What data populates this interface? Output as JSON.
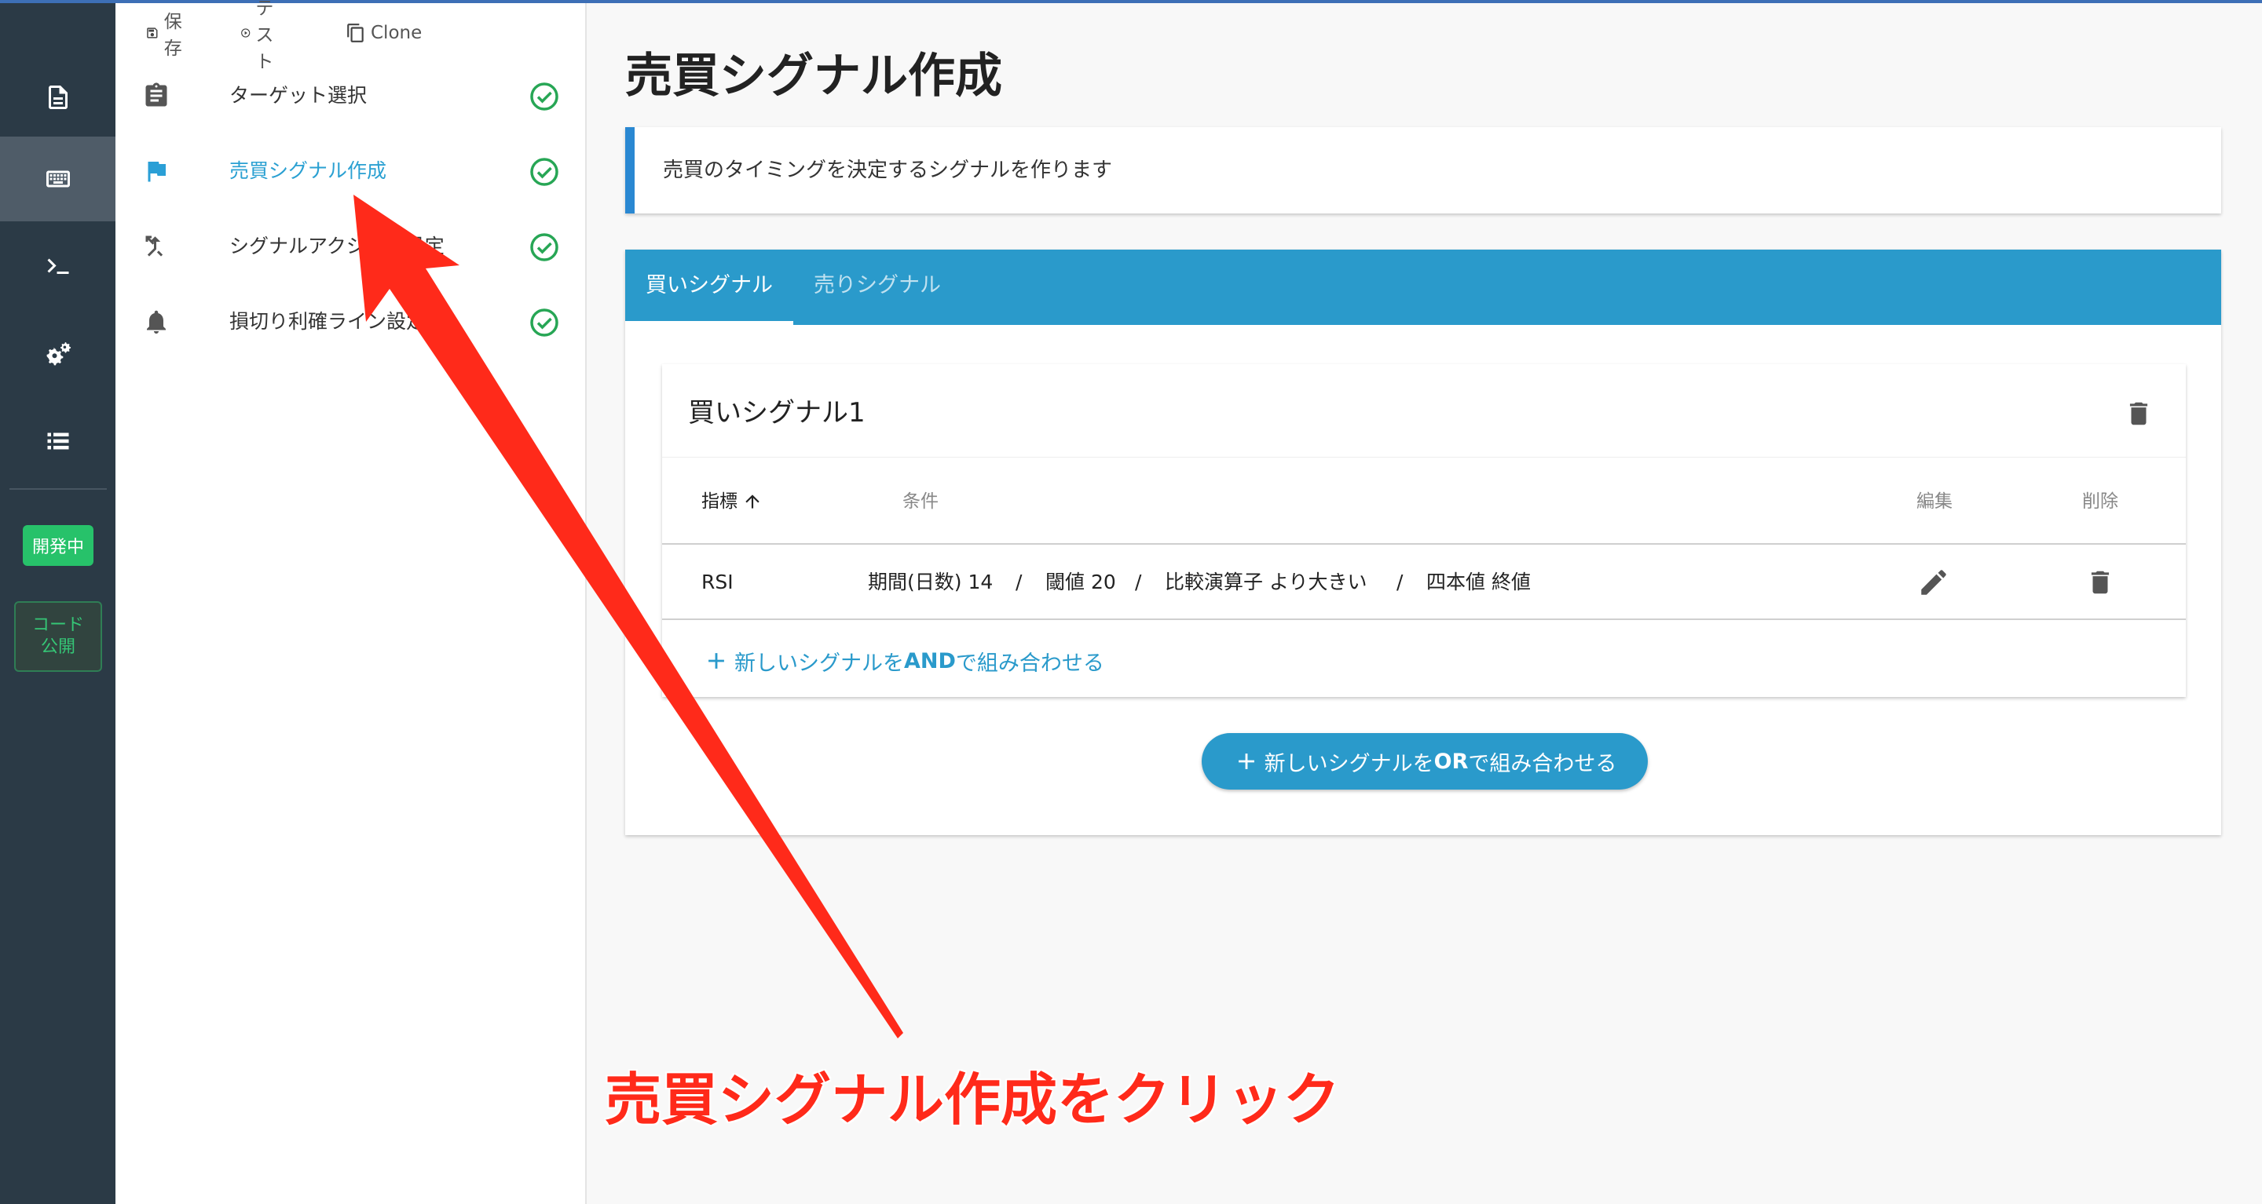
{
  "toolbar": {
    "save": "保存",
    "test": "テスト",
    "clone": "Clone"
  },
  "rail": {
    "dev_badge": "開発中",
    "code_badge_line1": "コード",
    "code_badge_line2": "公開"
  },
  "steps": [
    {
      "label": "ターゲット選択",
      "icon": "clipboard-icon",
      "done": true
    },
    {
      "label": "売買シグナル作成",
      "icon": "flag-icon",
      "done": true,
      "active": true
    },
    {
      "label": "シグナルアクション設定",
      "icon": "merge-icon",
      "done": true
    },
    {
      "label": "損切り利確ライン設定",
      "icon": "bell-icon",
      "done": true
    }
  ],
  "main": {
    "title": "売買シグナル作成",
    "info": "売買のタイミングを決定するシグナルを作ります",
    "tabs": [
      {
        "label": "買いシグナル",
        "active": true
      },
      {
        "label": "売りシグナル",
        "active": false
      }
    ],
    "signal": {
      "title": "買いシグナル1",
      "columns": {
        "indicator": "指標",
        "condition": "条件",
        "edit": "編集",
        "delete": "削除"
      },
      "rows": [
        {
          "indicator": "RSI",
          "c1": "期間(日数) 14",
          "sep": "/",
          "c2": "閾値 20",
          "c3": "比較演算子 より大きい",
          "c4": "四本値 終値"
        }
      ],
      "add_and": {
        "pre": "新しいシグナルを",
        "key": "AND",
        "post": "で組み合わせる"
      }
    },
    "add_or": {
      "pre": "新しいシグナルを",
      "key": "OR",
      "post": "で組み合わせる"
    }
  },
  "annotation": {
    "callout": "売買シグナル作成をクリック",
    "color": "#ff2a1a"
  },
  "colors": {
    "accent": "#2a9acb",
    "rail": "#2b3a46",
    "success": "#27a655"
  }
}
